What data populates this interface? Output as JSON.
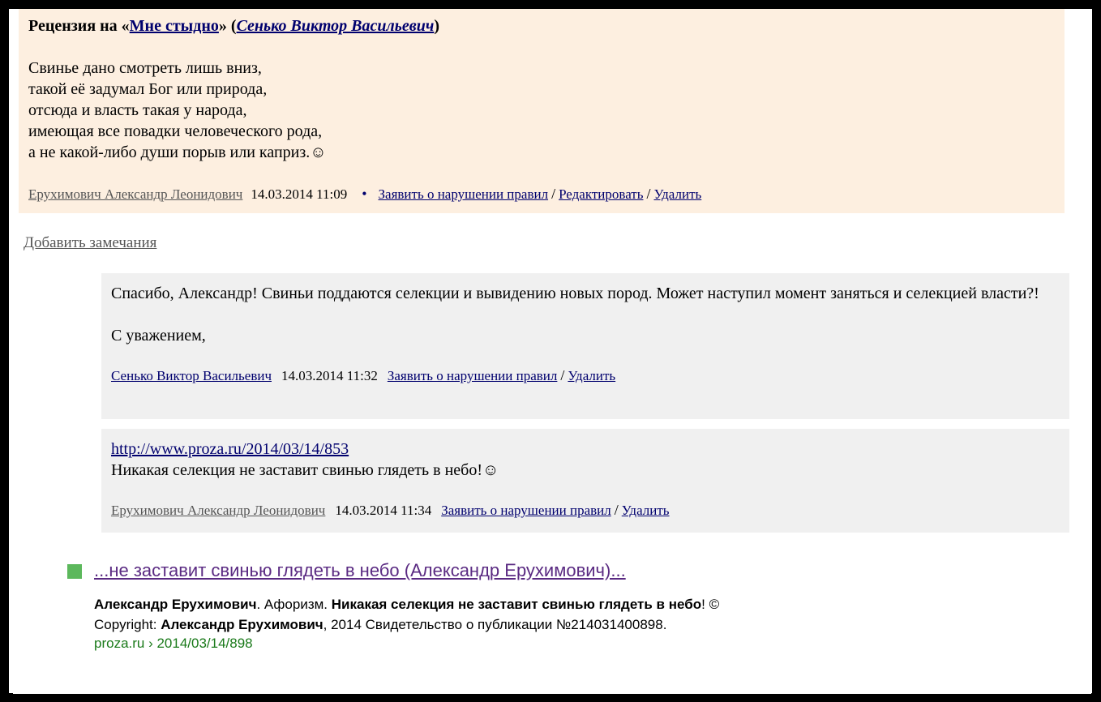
{
  "review": {
    "prefix": "Рецензия на «",
    "work_title": "Мне стыдно",
    "mid": "» (",
    "work_author": "Сенько Виктор Васильевич",
    "suffix": ")",
    "poem_lines": [
      "Свинье дано смотреть лишь вниз,",
      "такой её задумал Бог или природа,",
      "отсюда и власть такая у народа,",
      "имеющая все повадки человеческого рода,",
      "а не какой-либо души порыв или каприз.☺"
    ],
    "author": "Ерухимович Александр Леонидович",
    "date": "14.03.2014 11:09",
    "dot": "•",
    "report": "Заявить о нарушении правил",
    "sep": "/",
    "edit": "Редактировать",
    "delete": "Удалить"
  },
  "add_notes": "Добавить замечания",
  "reply1": {
    "text1": "Спасибо, Александр! Свиньи поддаются селекции и вывидению новых пород. Может наступил момент заняться и селекцией власти?!",
    "text2": "С уважением,",
    "author": "Сенько Виктор Васильевич",
    "date": "14.03.2014 11:32",
    "report": "Заявить о нарушении правил",
    "sep": "/",
    "delete": "Удалить"
  },
  "reply2": {
    "link": "http://www.proza.ru/2014/03/14/853",
    "text": "Никакая селекция не заставит свинью глядеть в небо!☺",
    "author": "Ерухимович Александр Леонидович",
    "date": "14.03.2014 11:34",
    "report": "Заявить о нарушении правил",
    "sep": "/",
    "delete": "Удалить"
  },
  "search_result": {
    "title": "...не заставит свинью глядеть в небо (Александр Ерухимович)...",
    "line1_b1": "Александр Ерухимович",
    "line1_t1": ". Афоризм. ",
    "line1_b2": "Никакая селекция не заставит свинью глядеть в небо",
    "line1_t2": "! ©",
    "line2_t1": "Copyright: ",
    "line2_b1": "Александр Ерухимович",
    "line2_t2": ", 2014 Свидетельство о публикации №214031400898.",
    "url": "proza.ru › 2014/03/14/898"
  },
  "colors": {
    "review_bg": "#fdefe0",
    "reply_bg": "#f0f0f0",
    "link": "#00006e",
    "result_title": "#5a2a82",
    "result_url": "#1a7a1a",
    "bullet": "#5cb85c"
  }
}
